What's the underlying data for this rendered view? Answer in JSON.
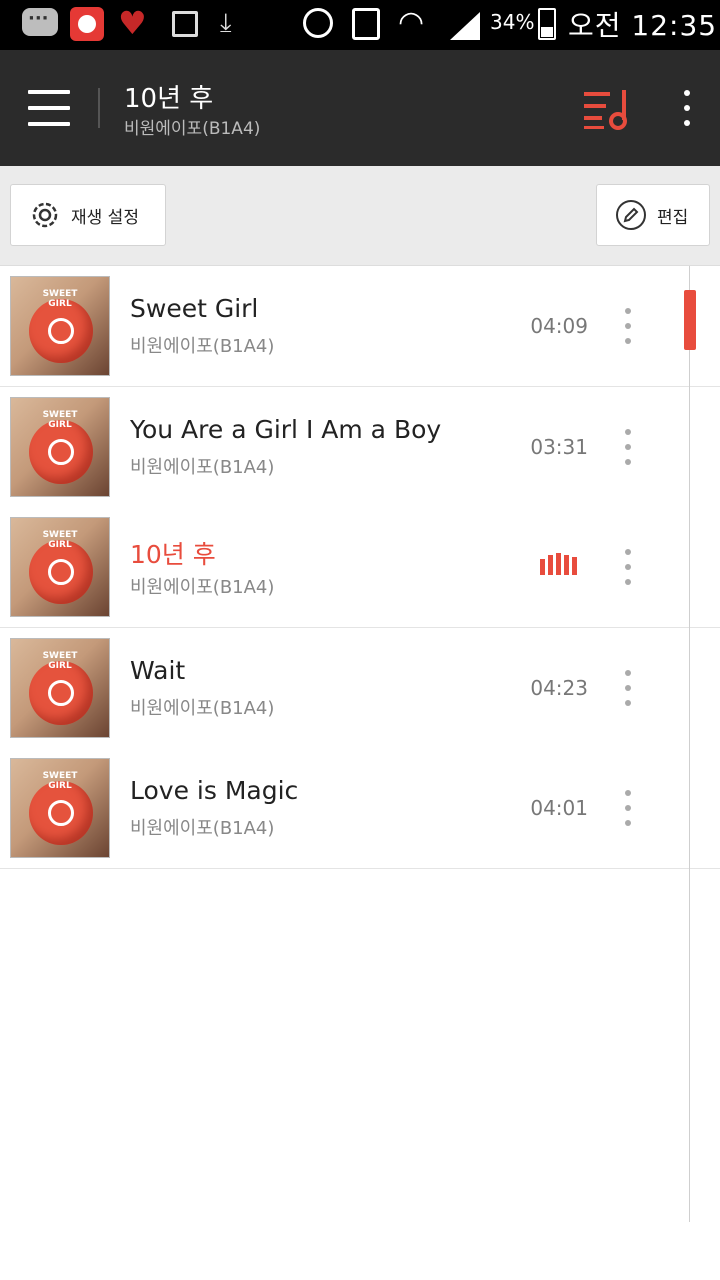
{
  "status_bar": {
    "battery_percent": "34%",
    "time": "오전 12:35",
    "icons": [
      "chat-icon",
      "youtube-icon",
      "heart-icon",
      "gallery-icon",
      "download-icon",
      "alarm-icon",
      "lock-icon",
      "wifi-icon",
      "signal-icon",
      "battery-icon"
    ]
  },
  "header": {
    "title": "10년 후",
    "subtitle": "비원에이포(B1A4)",
    "accent_color": "#e84c3d"
  },
  "toolbar": {
    "play_settings_label": "재생 설정",
    "edit_label": "편집"
  },
  "playlist": [
    {
      "title": "Sweet Girl",
      "artist": "비원에이포(B1A4)",
      "duration": "04:09",
      "active": false
    },
    {
      "title": "You Are a Girl I Am a Boy",
      "artist": "비원에이포(B1A4)",
      "duration": "03:31",
      "active": false
    },
    {
      "title": "10년 후",
      "artist": "비원에이포(B1A4)",
      "duration": "",
      "active": true
    },
    {
      "title": "Wait",
      "artist": "비원에이포(B1A4)",
      "duration": "04:23",
      "active": false
    },
    {
      "title": "Love is Magic",
      "artist": "비원에이포(B1A4)",
      "duration": "04:01",
      "active": false
    }
  ],
  "album_art_text": [
    "SWEET",
    "GIRL"
  ]
}
